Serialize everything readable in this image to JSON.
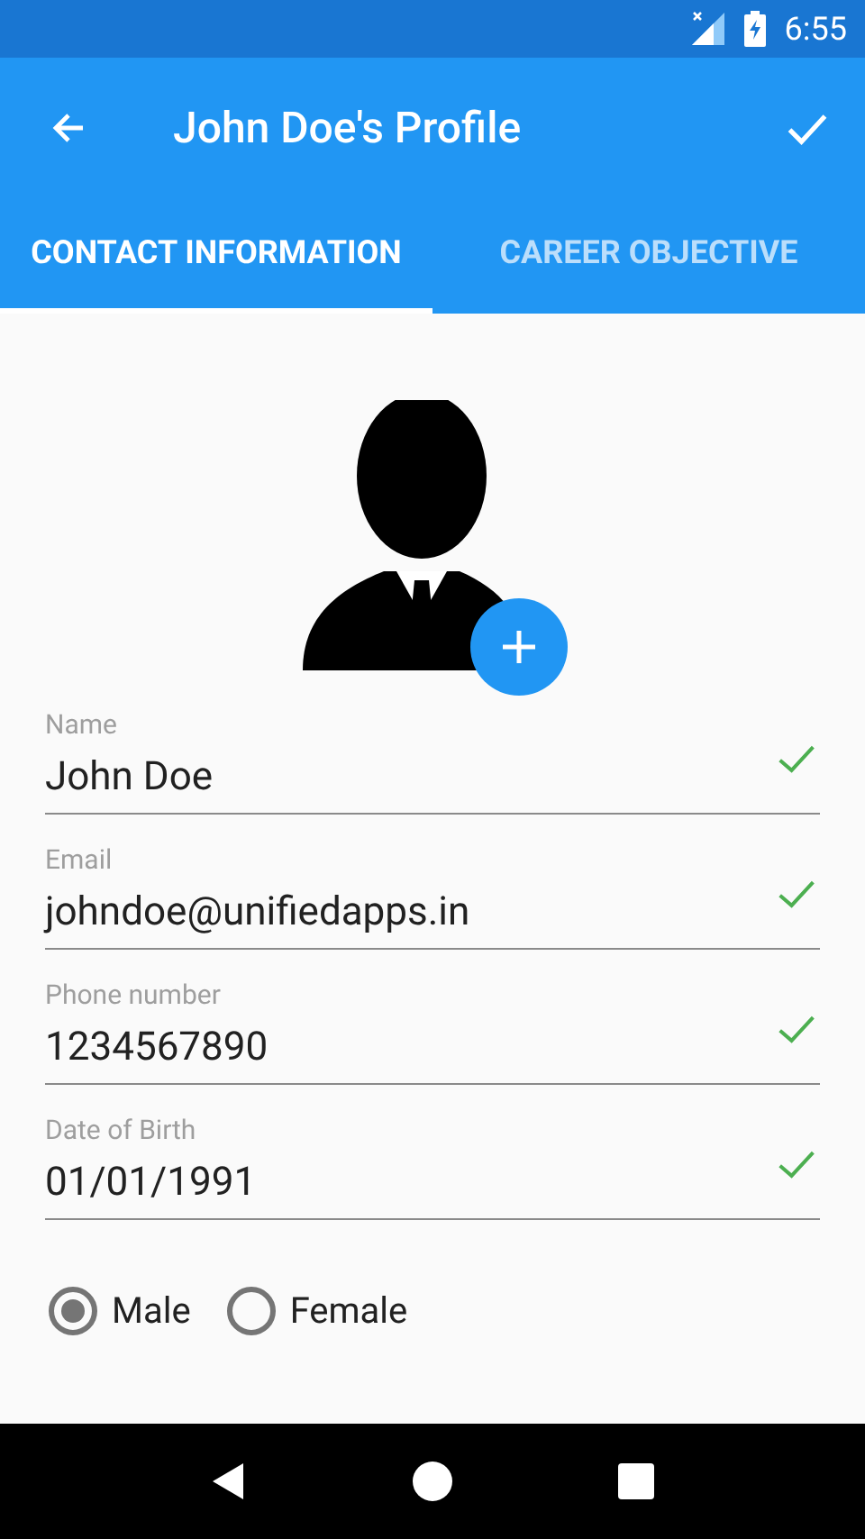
{
  "status_bar": {
    "time": "6:55"
  },
  "app_bar": {
    "title": "John Doe's Profile"
  },
  "tabs": [
    {
      "label": "CONTACT INFORMATION",
      "selected": true
    },
    {
      "label": "CAREER OBJECTIVE",
      "selected": false
    }
  ],
  "fields": [
    {
      "label": "Name",
      "value": "John Doe",
      "valid": true
    },
    {
      "label": "Email",
      "value": "johndoe@unifiedapps.in",
      "valid": true
    },
    {
      "label": "Phone number",
      "value": "1234567890",
      "valid": true
    },
    {
      "label": "Date of Birth",
      "value": "01/01/1991",
      "valid": true
    }
  ],
  "gender": [
    {
      "label": "Male",
      "selected": true
    },
    {
      "label": "Female",
      "selected": false
    }
  ]
}
